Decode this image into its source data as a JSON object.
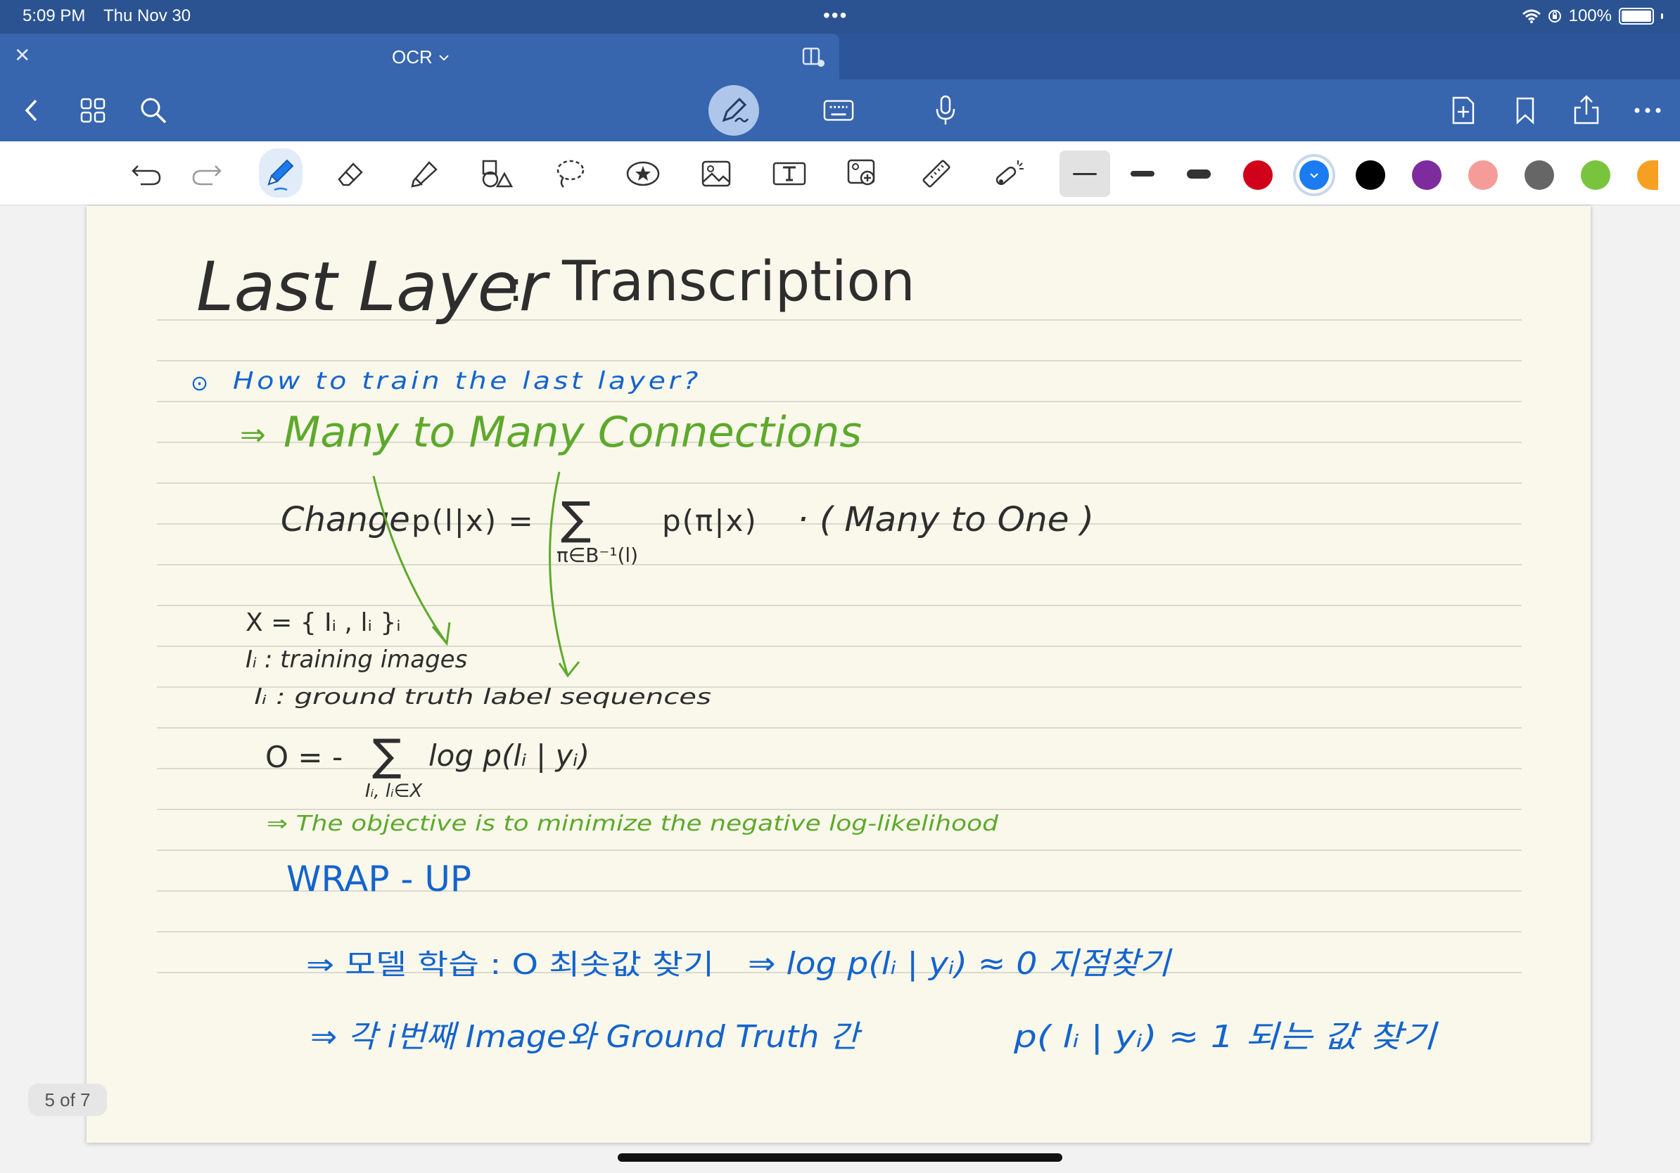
{
  "status": {
    "time": "5:09 PM",
    "date": "Thu Nov 30",
    "battery": "100%"
  },
  "document": {
    "title": "OCR",
    "page_indicator": "5 of 7"
  },
  "icons": {
    "status": [
      "more-dots-icon",
      "wifi-icon",
      "orientation-lock-icon",
      "battery-icon"
    ],
    "tab": [
      "close-icon",
      "chevron-down-icon",
      "split-view-icon"
    ],
    "nav": [
      "back-icon",
      "thumbnails-grid-icon",
      "search-icon",
      "pen-mode-icon",
      "keyboard-icon",
      "microphone-icon",
      "add-page-icon",
      "bookmark-icon",
      "share-icon",
      "more-icon"
    ],
    "tools": [
      "undo-icon",
      "redo-icon",
      "pen-icon",
      "eraser-icon",
      "highlighter-icon",
      "shapes-icon",
      "lasso-icon",
      "sticker-icon",
      "image-icon",
      "text-box-icon",
      "camera-image-icon",
      "ruler-icon",
      "laser-pointer-icon"
    ]
  },
  "colors": {
    "palette": [
      "#d0021b",
      "#1a7cf0",
      "#000000",
      "#7e2b9e",
      "#f59c98",
      "#666666",
      "#78c43c",
      "#f5a023"
    ],
    "selected": "#1a7cf0",
    "ink_blue": "#1464cc",
    "ink_green": "#5ea92c",
    "ink_dark": "#2e2e2e"
  },
  "notes": {
    "heading_left": "Last Layer",
    "heading_colon": ":",
    "heading_right": "Transcription",
    "question_bullet": "⊙",
    "question": "How to train the last layer?",
    "many_arrow": "⇒",
    "many_to_many": "Many to Many Connections",
    "change_word": "Change",
    "change_eq": "p(l|x) =",
    "sum_symbol": "∑",
    "sum_sub": "π∈B⁻¹(l)",
    "change_term": "p(π|x)",
    "many_to_one": "· ( Many to One )",
    "x_def": "X = { Iᵢ , lᵢ }ᵢ",
    "i_def": "Iᵢ : training images",
    "l_def": "lᵢ : ground truth label sequences",
    "obj_lhs": "O = -",
    "obj_sum": "∑",
    "obj_term": "log p(lᵢ | yᵢ)",
    "obj_sub": "Iᵢ, lᵢ∈X",
    "obj_note": "⇒ The objective is to minimize the negative log-likelihood",
    "wrap_up": "WRAP - UP",
    "wrap1_lhs": "⇒ 모델 학습 : O 최솟값 찾기",
    "wrap1_rhs": "⇒ log p(lᵢ | yᵢ) ≈ 0 지점찾기",
    "wrap2_lhs": "⇒ 각 i번째 Image와 Ground Truth 간",
    "wrap2_rhs": "p( lᵢ | yᵢ) ≈ 1 되는 값 찾기"
  }
}
